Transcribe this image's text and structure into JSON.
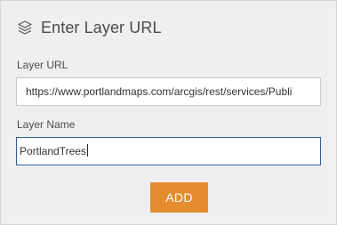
{
  "header": {
    "icon": "layers-icon",
    "title": "Enter Layer URL"
  },
  "form": {
    "layer_url": {
      "label": "Layer URL",
      "value": "https://www.portlandmaps.com/arcgis/rest/services/Publi"
    },
    "layer_name": {
      "label": "Layer Name",
      "value": "PortlandTrees"
    },
    "add_button_label": "ADD"
  },
  "colors": {
    "panel_background": "#efefef",
    "accent_button": "#e58c2f",
    "focus_border": "#2f5e93"
  }
}
